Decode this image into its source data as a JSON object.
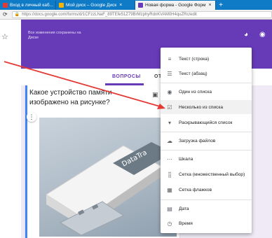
{
  "browser": {
    "tabs": [
      {
        "title": "Вход в личный каб...",
        "close": "×",
        "color": "#e53935"
      },
      {
        "title": "Мой диск – Google Диск",
        "close": "×",
        "color": "#f4b400"
      },
      {
        "title": "Новая форма - Google Форм",
        "close": "×",
        "color": "#673ab7"
      }
    ],
    "new_tab": "+",
    "url": "https://docs.google.com/forms/d/1CFzzLNaF_89TEfe51Z79BrMzphyRdnKVAM0H4quZRc/edit"
  },
  "header": {
    "saved_text": "Все изменения сохранены на Диске",
    "accent": "#673ab7"
  },
  "tabs": {
    "questions": "ВОПРОСЫ",
    "answers": "ОТВЕ"
  },
  "question": {
    "title": "Какое устройство памяти изображено на рисунке?",
    "photo_text": "DataTra"
  },
  "menu": {
    "items": [
      {
        "label": "Текст (строка)",
        "icon": "short-text-icon"
      },
      {
        "label": "Текст (абзац)",
        "icon": "paragraph-icon"
      },
      {
        "label": "Один из списка",
        "icon": "radio-icon"
      },
      {
        "label": "Несколько из списка",
        "icon": "checkbox-icon"
      },
      {
        "label": "Раскрывающийся список",
        "icon": "dropdown-icon"
      },
      {
        "label": "Загрузка файлов",
        "icon": "cloud-upload-icon"
      },
      {
        "label": "Шкала",
        "icon": "scale-icon"
      },
      {
        "label": "Сетка (множественный выбор)",
        "icon": "grid-radio-icon"
      },
      {
        "label": "Сетка флажков",
        "icon": "grid-checkbox-icon"
      },
      {
        "label": "Дата",
        "icon": "calendar-icon"
      },
      {
        "label": "Время",
        "icon": "clock-icon"
      }
    ]
  }
}
